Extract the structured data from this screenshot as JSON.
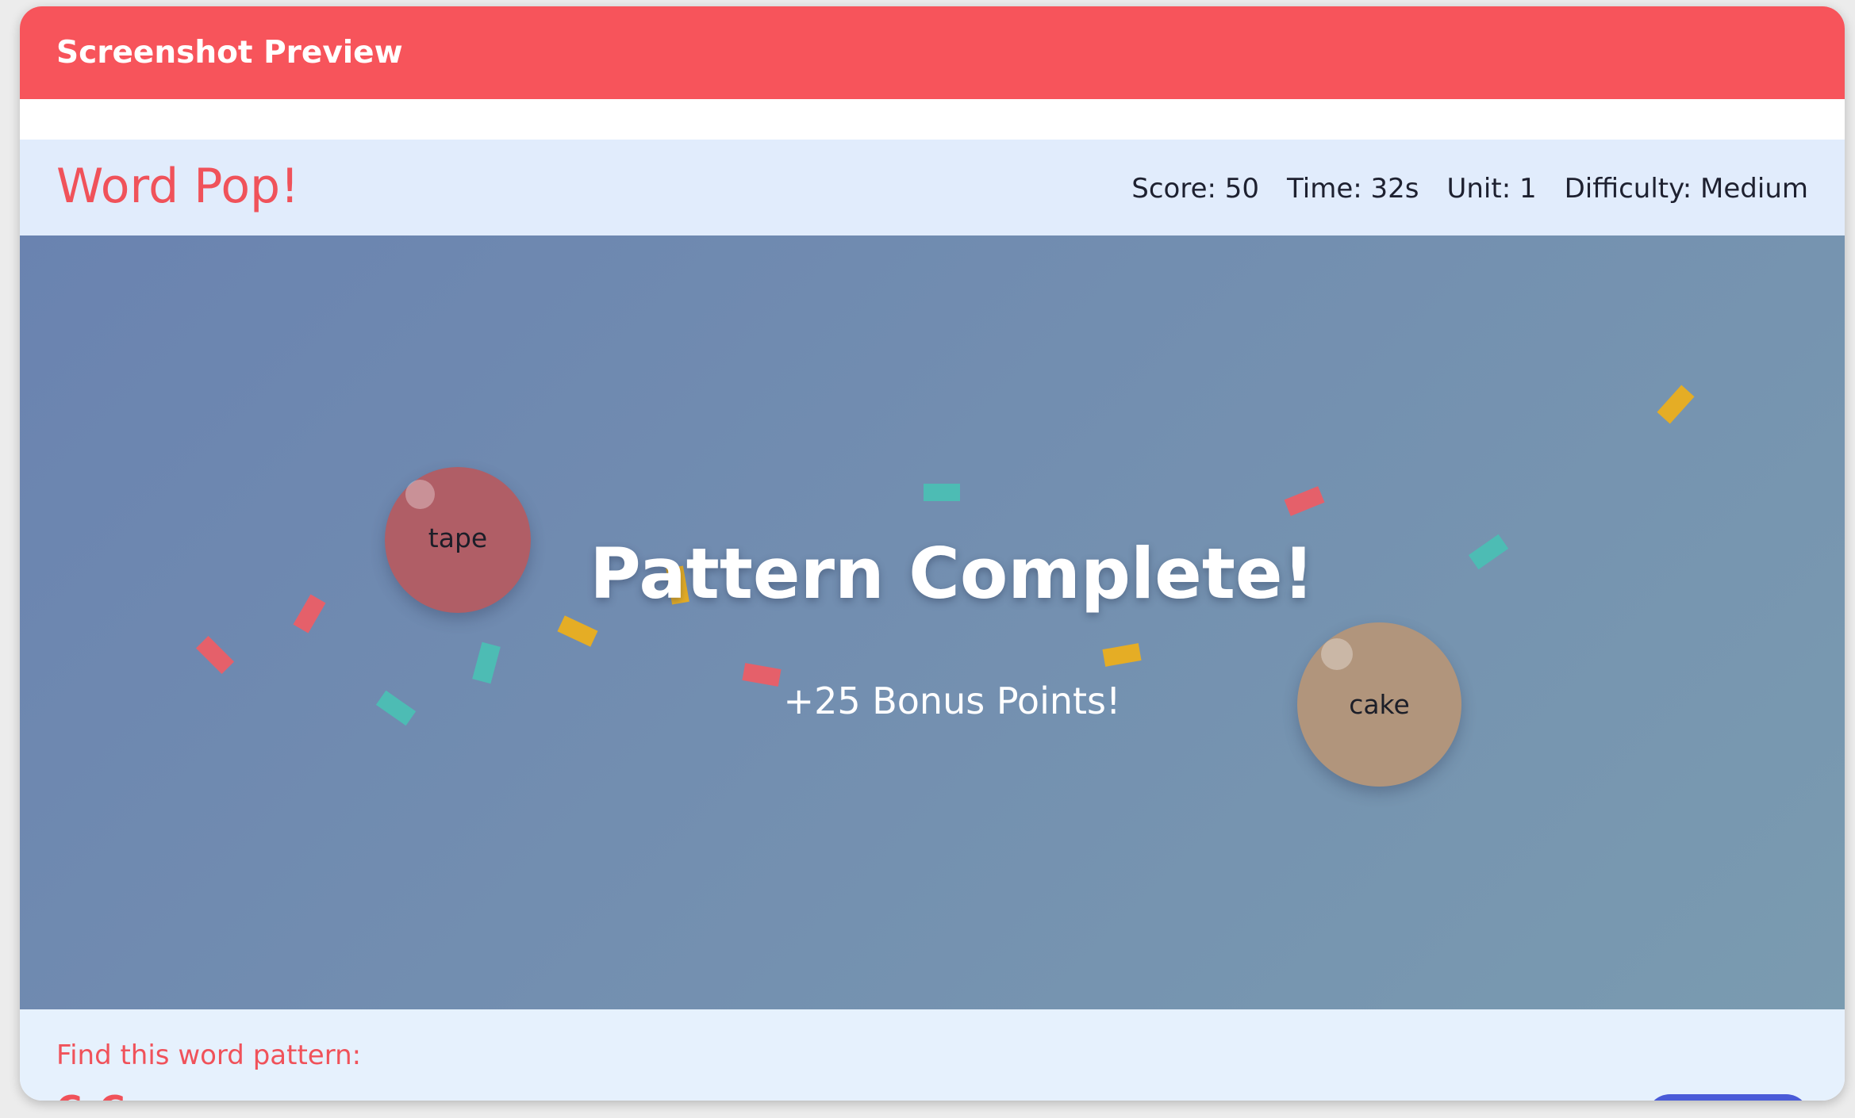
{
  "window": {
    "title": "Screenshot Preview"
  },
  "header": {
    "game_title": "Word Pop!",
    "stats": {
      "score": "Score: 50",
      "time": "Time: 32s",
      "unit": "Unit: 1",
      "difficulty": "Difficulty: Medium"
    }
  },
  "play_area": {
    "bubbles": [
      {
        "word": "tape",
        "color": "#b05e66"
      },
      {
        "word": "cake",
        "color": "#b1957c"
      }
    ],
    "message": {
      "title": "Pattern Complete!",
      "subtitle": "+25 Bonus Points!"
    },
    "confetti_colors": [
      "#e5606a",
      "#4dbcb4",
      "#e5ad25"
    ]
  },
  "bottom": {
    "prompt_label": "Find this word pattern:",
    "pattern": "C_C"
  },
  "colors": {
    "accent": "#f7545b",
    "header_bg": "#e1ecfc",
    "button": "#4a5bd8"
  }
}
